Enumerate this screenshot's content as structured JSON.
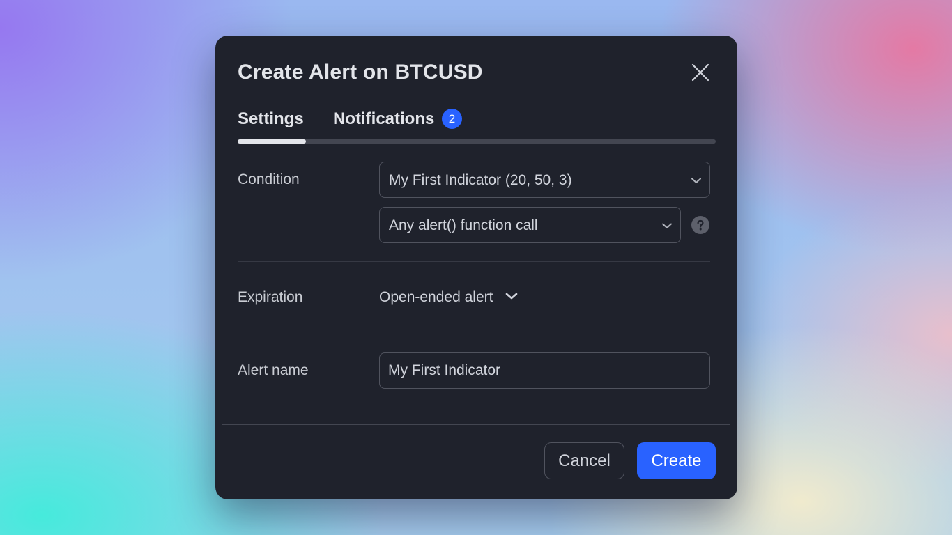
{
  "dialog": {
    "title": "Create Alert on BTCUSD",
    "close_icon": "close-icon"
  },
  "tabs": {
    "items": [
      {
        "label": "Settings",
        "active": true
      },
      {
        "label": "Notifications",
        "badge": "2"
      }
    ]
  },
  "condition": {
    "label": "Condition",
    "indicator_value": "My First Indicator (20, 50, 3)",
    "trigger_value": "Any alert() function call",
    "help_icon": "help-icon"
  },
  "expiration": {
    "label": "Expiration",
    "value": "Open-ended alert"
  },
  "alert_name": {
    "label": "Alert name",
    "value": "My First Indicator"
  },
  "footer": {
    "cancel_label": "Cancel",
    "create_label": "Create"
  },
  "colors": {
    "dialog_bg": "#1f222c",
    "accent": "#2962ff",
    "border": "#50535e"
  }
}
